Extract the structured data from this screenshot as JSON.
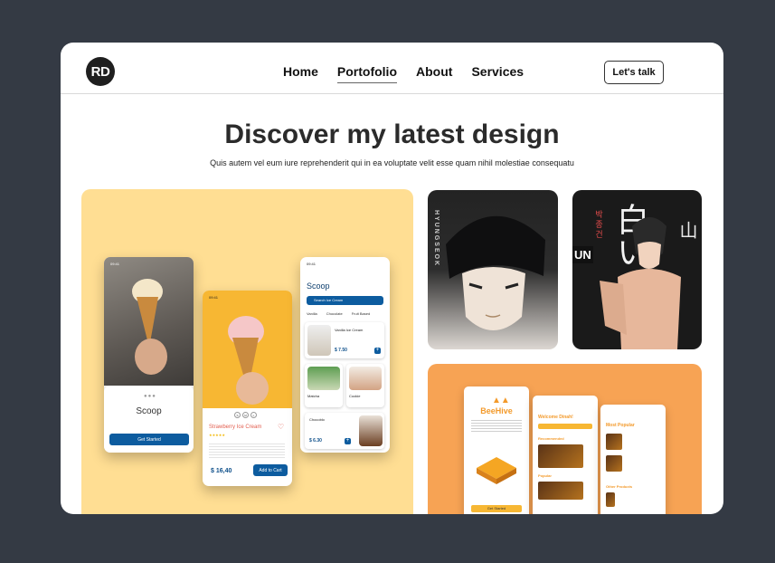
{
  "logo": "RD",
  "nav": {
    "items": [
      {
        "label": "Home",
        "active": false
      },
      {
        "label": "Portofolio",
        "active": true
      },
      {
        "label": "About",
        "active": false
      },
      {
        "label": "Services",
        "active": false
      }
    ],
    "cta": "Let's talk"
  },
  "hero": {
    "title": "Discover my latest design",
    "subtitle": "Quis autem vel eum iure reprehenderit qui in ea voluptate velit esse quam nihil molestiae consequatu"
  },
  "scoop_app": {
    "background": "#ffde93",
    "accent": "#0d5c9f",
    "onboarding": {
      "time": "09:41",
      "name": "Scoop",
      "button": "Get Started"
    },
    "detail": {
      "time": "09:41",
      "product": "Strawberry Ice Cream",
      "price": "$ 16,40",
      "button": "Add to Cart",
      "sizes": [
        "S",
        "M",
        "L"
      ]
    },
    "home": {
      "time": "09:41",
      "title": "Scoop",
      "search_placeholder": "Search Ice Cream",
      "tabs": [
        "Vanilla",
        "Chocolate",
        "Fruit Based"
      ],
      "items": [
        {
          "name": "Vanilla Ice Cream",
          "price": "$ 7.50"
        },
        {
          "name": "Matcha"
        },
        {
          "name": "Cookie"
        },
        {
          "name": "Chocoblo",
          "price": "$ 6.30"
        }
      ]
    }
  },
  "manga1": {
    "vertical_text": "HYUNGSEOK"
  },
  "manga2": {
    "name_korean": "박종건",
    "big_chars": "白い",
    "side_chars": "山",
    "partial_text": "UN"
  },
  "beehive": {
    "background": "#f7a354",
    "app_name": "BeeHive",
    "start_button": "Get Started",
    "welcome": "Welcome Dinah!",
    "sections": [
      "Recommended",
      "Popular",
      "Most Popular",
      "Other Products"
    ]
  }
}
